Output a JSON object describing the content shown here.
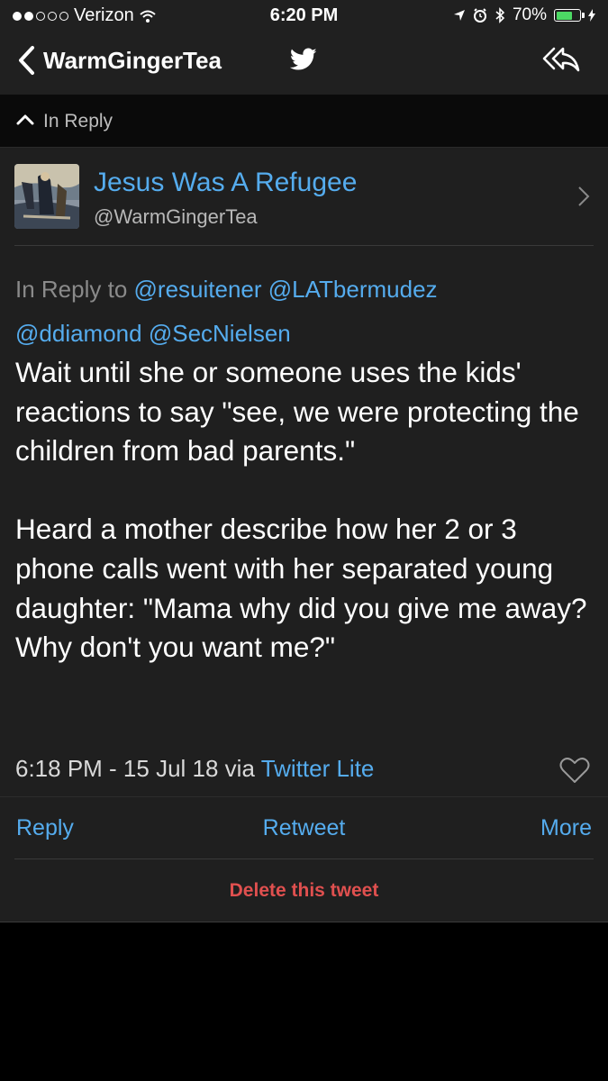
{
  "status_bar": {
    "carrier": "Verizon",
    "time": "6:20 PM",
    "battery": "70%",
    "battery_level": 0.7
  },
  "nav": {
    "title": "WarmGingerTea",
    "bird_icon": "twitter-bird-icon",
    "share_icon": "reply-all-icon"
  },
  "in_reply_bar": {
    "label": "In Reply"
  },
  "tweet": {
    "display_name": "Jesus Was A Refugee",
    "handle": "@WarmGingerTea",
    "reply_to_prefix": "In Reply to",
    "mentions_line1": [
      "@resuitener",
      "@LATbermudez"
    ],
    "mentions_line2": [
      "@ddiamond",
      "@SecNielsen"
    ],
    "body": "Wait until she or someone uses the kids' reactions to say \"see, we were protecting the children from bad parents.\"\n\nHeard a mother describe how her 2 or 3 phone calls went with her separated young daughter: \"Mama why did you give me away? Why don't you want me?\"",
    "timestamp": "6:18 PM - 15 Jul 18 via",
    "via": "Twitter Lite"
  },
  "actions": {
    "reply": "Reply",
    "retweet": "Retweet",
    "more": "More",
    "delete": "Delete this tweet"
  },
  "colors": {
    "link": "#55acee",
    "delete": "#e0504f",
    "battery": "#4cd964"
  }
}
